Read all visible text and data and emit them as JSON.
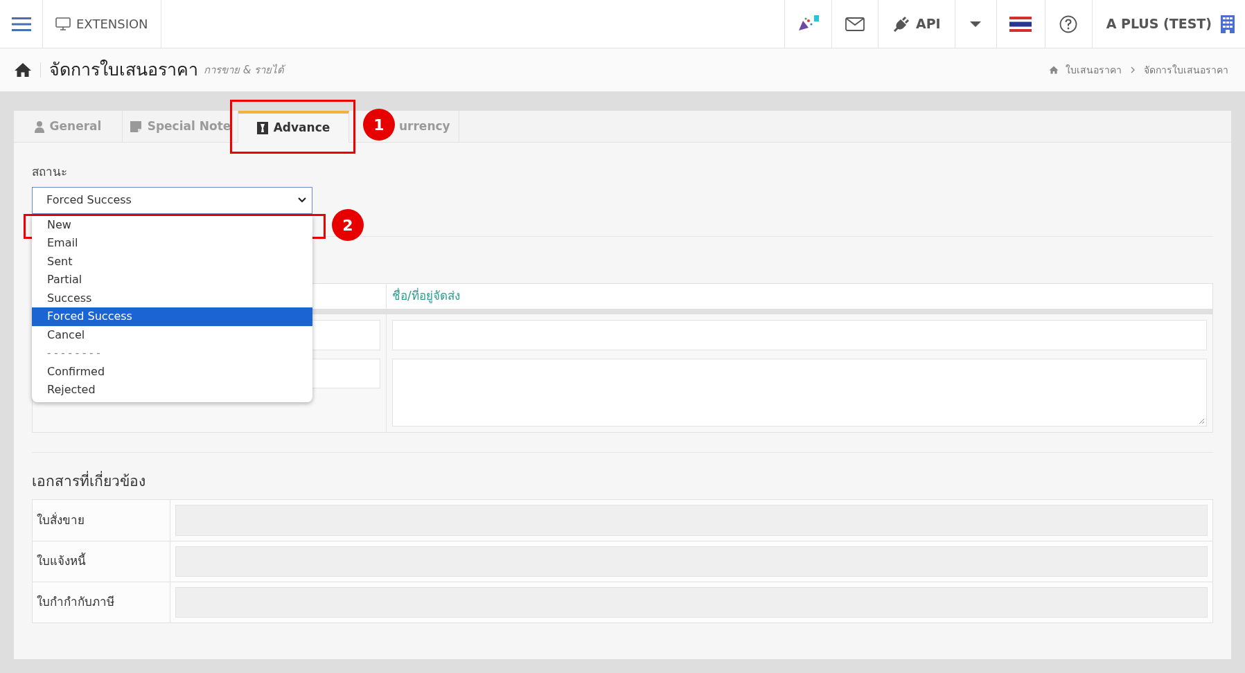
{
  "topbar": {
    "extension_label": "EXTENSION",
    "api_label": "API",
    "user_label": "A PLUS (TEST)"
  },
  "header": {
    "title": "จัดการใบเสนอราคา",
    "subtitle": "การขาย & รายได้",
    "breadcrumbs": [
      "ใบเสนอราคา",
      "จัดการใบเสนอราคา"
    ]
  },
  "tabs": [
    {
      "label": "General",
      "selected": false
    },
    {
      "label": "Special Note",
      "selected": false
    },
    {
      "label": "Advance",
      "selected": true
    },
    {
      "label": "urrency",
      "selected": false
    }
  ],
  "status_field": {
    "label": "สถานะ",
    "value": "Forced Success",
    "expanded": true,
    "options": [
      {
        "kind": "option",
        "label": "New",
        "selected": false
      },
      {
        "kind": "option",
        "label": "Email",
        "selected": false
      },
      {
        "kind": "option",
        "label": "Sent",
        "selected": false
      },
      {
        "kind": "option",
        "label": "Partial",
        "selected": false
      },
      {
        "kind": "option",
        "label": "Success",
        "selected": false
      },
      {
        "kind": "option",
        "label": "Forced Success",
        "selected": true
      },
      {
        "kind": "option",
        "label": "Cancel",
        "selected": false
      },
      {
        "kind": "separator",
        "label": "- - - - - - - -"
      },
      {
        "kind": "option",
        "label": "Confirmed",
        "selected": false
      },
      {
        "kind": "option",
        "label": "Rejected",
        "selected": false
      }
    ]
  },
  "shipping_table": {
    "column_2": "ชื่อ/ที่อยู่จัดส่ง"
  },
  "related_documents": {
    "title": "เอกสารที่เกี่ยวข้อง",
    "rows": [
      {
        "label": "ใบสั่งขาย"
      },
      {
        "label": "ใบแจ้งหนี้"
      },
      {
        "label": "ใบกำกำกับภาษี"
      }
    ]
  },
  "annotations": [
    {
      "label": "1"
    },
    {
      "label": "2"
    }
  ]
}
